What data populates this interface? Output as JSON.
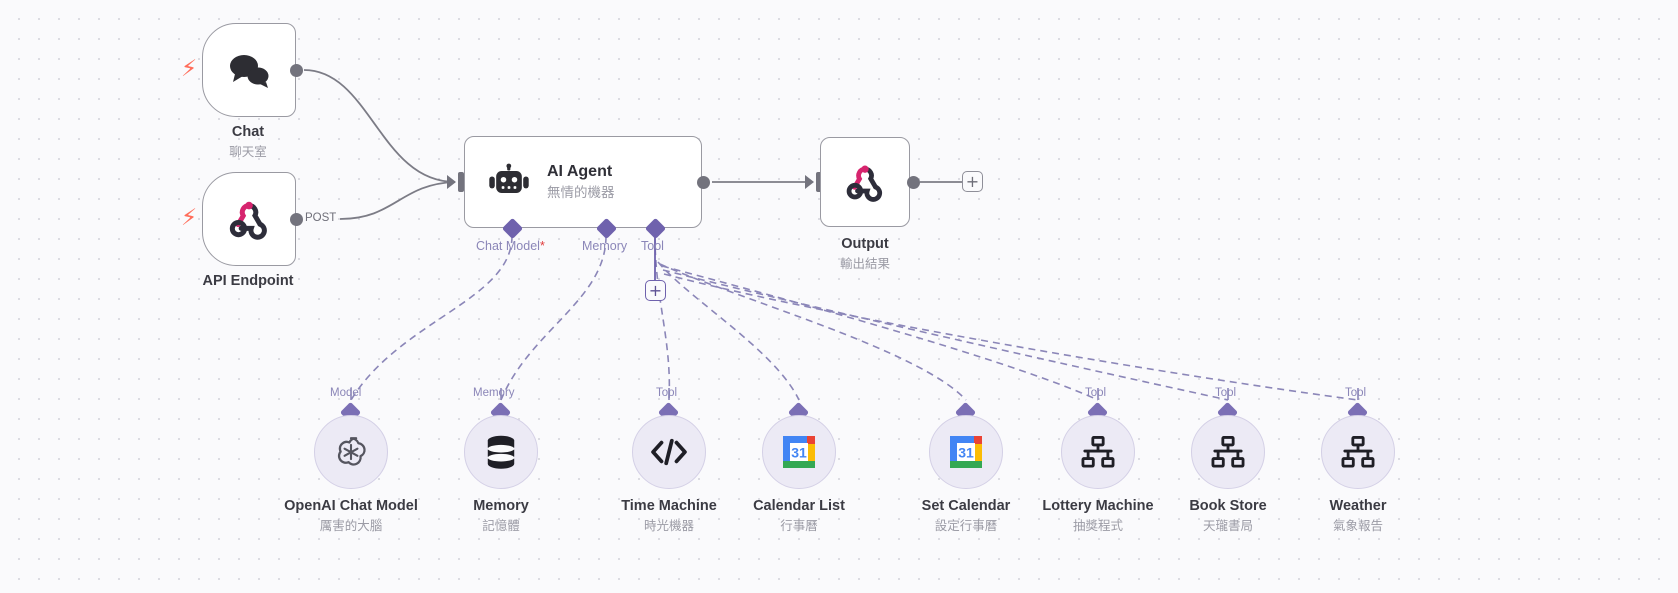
{
  "canvas": {
    "background_color": "#fafafc",
    "grid_dot_color": "#d6d6de",
    "accent_purple": "#6f62ad",
    "connector_gray": "#73737d",
    "trigger_bolt_color": "#ff6d5a"
  },
  "trigger_nodes": [
    {
      "id": "chat",
      "title": "Chat",
      "subtitle": "聊天室",
      "icon": "chat-bubbles-icon",
      "bolt": "⚡",
      "output_label": ""
    },
    {
      "id": "api-endpoint",
      "title": "API Endpoint",
      "subtitle": "",
      "icon": "webhook-icon",
      "bolt": "⚡",
      "output_label": "POST"
    }
  ],
  "agent": {
    "title": "AI Agent",
    "subtitle": "無情的機器",
    "icon": "robot-icon",
    "ports": [
      {
        "label": "Chat Model",
        "required": "*"
      },
      {
        "label": "Memory",
        "required": ""
      },
      {
        "label": "Tool",
        "required": ""
      }
    ],
    "add_tool_button": "+"
  },
  "output_node": {
    "title": "Output",
    "subtitle": "輸出結果",
    "icon": "webhook-icon",
    "add_button": "+"
  },
  "sub_nodes": [
    {
      "port": "Model",
      "title": "OpenAI Chat Model",
      "subtitle": "厲害的大腦",
      "icon": "openai-icon"
    },
    {
      "port": "Memory",
      "title": "Memory",
      "subtitle": "記憶體",
      "icon": "database-icon"
    },
    {
      "port": "Tool",
      "title": "Time Machine",
      "subtitle": "時光機器",
      "icon": "code-icon"
    },
    {
      "port": "",
      "title": "Calendar List",
      "subtitle": "行事曆",
      "icon": "google-calendar-icon"
    },
    {
      "port": "",
      "title": "Set Calendar",
      "subtitle": "設定行事曆",
      "icon": "google-calendar-icon"
    },
    {
      "port": "Tool",
      "title": "Lottery Machine",
      "subtitle": "抽獎程式",
      "icon": "sitemap-icon"
    },
    {
      "port": "Tool",
      "title": "Book Store",
      "subtitle": "天瓏書局",
      "icon": "sitemap-icon"
    },
    {
      "port": "Tool",
      "title": "Weather",
      "subtitle": "氣象報告",
      "icon": "sitemap-icon"
    }
  ]
}
